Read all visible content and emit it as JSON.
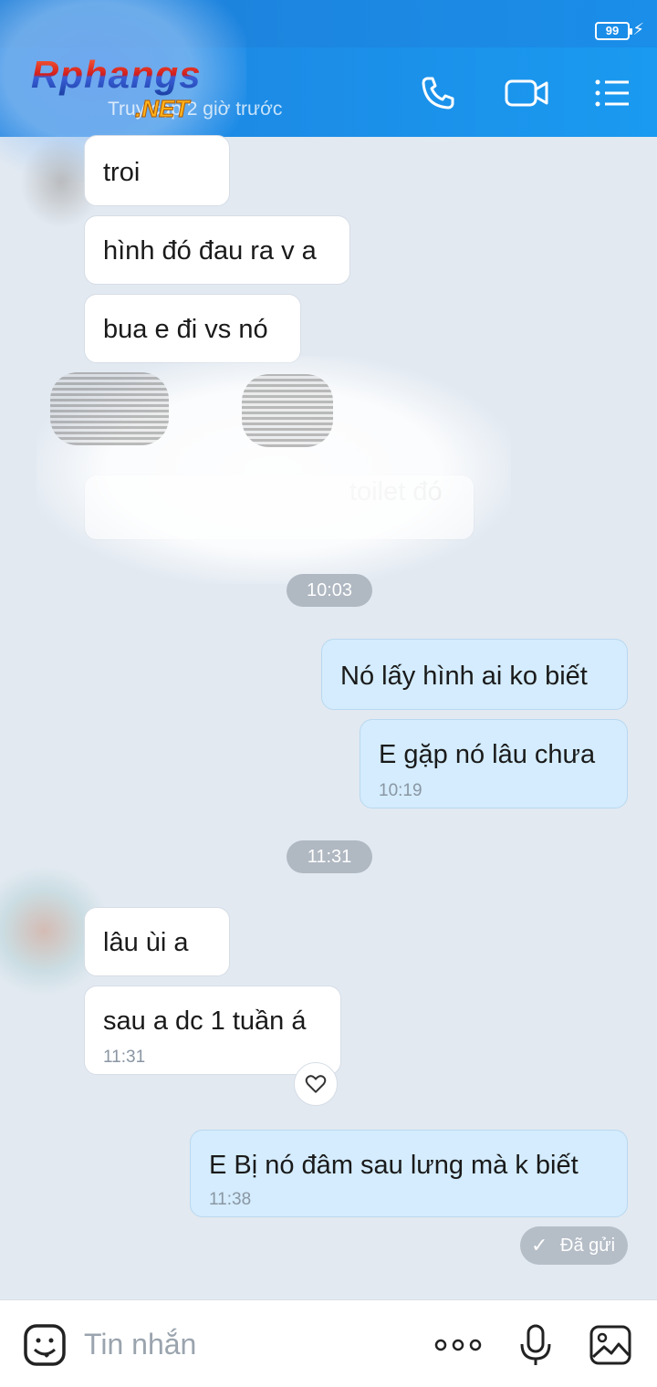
{
  "status": {
    "battery": "99"
  },
  "header": {
    "logo_main": "Rphangs",
    "logo_net": ".NET",
    "subtitle": "Truy cập 2 giờ trước"
  },
  "messages": {
    "in1": "troi",
    "in2": "hình đó đau ra v a",
    "in3": "bua e đi vs nó",
    "in_blur": "toilet đó",
    "pill1": "10:03",
    "out1": "Nó lấy hình ai ko biết",
    "out2": "E gặp nó lâu chưa",
    "out2_time": "10:19",
    "pill2": "11:31",
    "in4": "lâu ùi a",
    "in5": "sau a dc 1 tuần á",
    "in5_time": "11:31",
    "out3": "E Bị nó đâm sau lưng mà k biết",
    "out3_time": "11:38",
    "sent_status": "Đã gửi"
  },
  "composer": {
    "placeholder": "Tin nhắn"
  },
  "icons": {
    "call": "phone-icon",
    "video": "video-icon",
    "menu": "menu-icon",
    "sticker": "sticker-icon",
    "more": "more-icon",
    "mic": "mic-icon",
    "image": "image-icon"
  },
  "colors": {
    "header": "#1a8ee9",
    "outgoing_bubble": "#d4ecfd",
    "background": "#e2e9f1"
  }
}
